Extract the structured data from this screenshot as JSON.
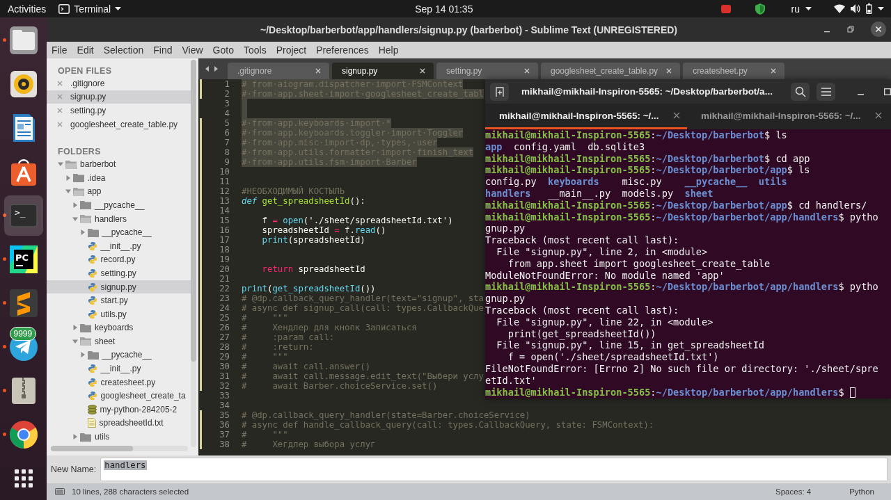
{
  "top_bar": {
    "activities": "Activities",
    "app_menu": "Terminal",
    "clock": "Sep 14  01:35",
    "keyboard_layout": "ru"
  },
  "dock": [
    {
      "kind": "files",
      "running": true,
      "active": false
    },
    {
      "kind": "music",
      "running": false,
      "active": false
    },
    {
      "kind": "writer",
      "running": false,
      "active": false
    },
    {
      "kind": "store",
      "running": false,
      "active": false
    },
    {
      "kind": "terminal",
      "label": ">_",
      "running": true,
      "active": true
    },
    {
      "kind": "pycharm",
      "label": "PC",
      "running": true,
      "active": false
    },
    {
      "kind": "sublime",
      "running": true,
      "active": false
    },
    {
      "kind": "telegram",
      "badge": "9999",
      "running": true,
      "active": false
    },
    {
      "kind": "archive",
      "running": true,
      "active": false
    },
    {
      "kind": "chrome",
      "running": true,
      "active": false
    },
    {
      "kind": "apps",
      "running": false,
      "active": false
    }
  ],
  "sublime": {
    "title": "~/Desktop/barberbot/app/handlers/signup.py (barberbot) - Sublime Text (UNREGISTERED)",
    "menu": [
      "File",
      "Edit",
      "Selection",
      "Find",
      "View",
      "Goto",
      "Tools",
      "Project",
      "Preferences",
      "Help"
    ],
    "sidebar": {
      "open_files_heading": "OPEN FILES",
      "open_files": [
        {
          "label": ".gitignore",
          "selected": false
        },
        {
          "label": "signup.py",
          "selected": true
        },
        {
          "label": "setting.py",
          "selected": false
        },
        {
          "label": "googlesheet_create_table.py",
          "selected": false
        }
      ],
      "folders_heading": "FOLDERS",
      "folders": [
        {
          "label": "barberbot",
          "kind": "folder",
          "expanded": true,
          "selected": false,
          "children": [
            {
              "label": ".idea",
              "kind": "folder",
              "expanded": false,
              "selected": false
            },
            {
              "label": "app",
              "kind": "folder",
              "expanded": true,
              "selected": false,
              "children": [
                {
                  "label": "__pycache__",
                  "kind": "folder",
                  "expanded": false,
                  "selected": false
                },
                {
                  "label": "handlers",
                  "kind": "folder",
                  "expanded": true,
                  "selected": false,
                  "children": [
                    {
                      "label": "__pycache__",
                      "kind": "folder",
                      "expanded": false,
                      "selected": false
                    },
                    {
                      "label": "__init__.py",
                      "kind": "python",
                      "selected": false
                    },
                    {
                      "label": "record.py",
                      "kind": "python",
                      "selected": false
                    },
                    {
                      "label": "setting.py",
                      "kind": "python",
                      "selected": false
                    },
                    {
                      "label": "signup.py",
                      "kind": "python",
                      "selected": true
                    },
                    {
                      "label": "start.py",
                      "kind": "python",
                      "selected": false
                    },
                    {
                      "label": "utils.py",
                      "kind": "python",
                      "selected": false
                    }
                  ]
                },
                {
                  "label": "keyboards",
                  "kind": "folder",
                  "expanded": false,
                  "selected": false
                },
                {
                  "label": "sheet",
                  "kind": "folder",
                  "expanded": true,
                  "selected": false,
                  "children": [
                    {
                      "label": "__pycache__",
                      "kind": "folder",
                      "expanded": false,
                      "selected": false
                    },
                    {
                      "label": "__init__.py",
                      "kind": "python",
                      "selected": false
                    },
                    {
                      "label": "createsheet.py",
                      "kind": "python",
                      "selected": false
                    },
                    {
                      "label": "googlesheet_create_ta",
                      "kind": "python",
                      "selected": false
                    },
                    {
                      "label": "my-python-284205-2",
                      "kind": "data",
                      "selected": false
                    },
                    {
                      "label": "spreadsheetId.txt",
                      "kind": "text",
                      "selected": false
                    }
                  ]
                },
                {
                  "label": "utils",
                  "kind": "folder",
                  "expanded": false,
                  "selected": false
                }
              ]
            }
          ]
        }
      ]
    },
    "tabs": [
      {
        "label": ".gitignore",
        "selected": false
      },
      {
        "label": "signup.py",
        "selected": true
      },
      {
        "label": "setting.py",
        "selected": false
      },
      {
        "label": "googlesheet_create_table.py",
        "selected": false
      },
      {
        "label": "createsheet.py",
        "selected": false
      }
    ],
    "code": [
      {
        "n": "1",
        "modified": true,
        "selected": true,
        "segments": [
          {
            "kind": "comment",
            "text": "# from·aiogram.dispatcher·import·FSMContext"
          }
        ]
      },
      {
        "n": "2",
        "modified": true,
        "selected": true,
        "segments": [
          {
            "kind": "comment",
            "text": "#·from·app.sheet·import·googlesheet_create_tabl"
          }
        ]
      },
      {
        "n": "3",
        "modified": false,
        "selected": true
      },
      {
        "n": "4",
        "modified": false,
        "selected": true
      },
      {
        "n": "5",
        "modified": true,
        "selected": true,
        "segments": [
          {
            "kind": "comment",
            "text": "#·from·app.keyboards·import·*"
          }
        ]
      },
      {
        "n": "6",
        "modified": true,
        "selected": true,
        "segments": [
          {
            "kind": "comment",
            "text": "#·from·app.keyboards.toggler·import·Toggler"
          }
        ]
      },
      {
        "n": "7",
        "modified": true,
        "selected": true,
        "segments": [
          {
            "kind": "comment",
            "text": "#·from·app.misc·import·dp,·types,·user"
          }
        ]
      },
      {
        "n": "8",
        "modified": true,
        "selected": true,
        "segments": [
          {
            "kind": "comment",
            "text": "#·from·app.utils.formatter·import·finish_text"
          }
        ]
      },
      {
        "n": "9",
        "modified": true,
        "selected": true,
        "segments": [
          {
            "kind": "comment",
            "text": "#·from·app.utils.fsm·import·Barber"
          }
        ]
      },
      {
        "n": "10",
        "modified": true,
        "selected": false
      },
      {
        "n": "11",
        "modified": true,
        "selected": false
      },
      {
        "n": "12",
        "modified": true,
        "selected": false,
        "segments": [
          {
            "kind": "comment",
            "text": "#НЕОБХОДИМЫЙ КОСТЫЛЬ"
          }
        ]
      },
      {
        "n": "13",
        "modified": true,
        "selected": false,
        "segments": [
          {
            "kind": "keyword",
            "text": "def"
          },
          {
            "kind": "name",
            "text": " get_spreadsheetId"
          },
          {
            "kind": "text",
            "text": "():"
          }
        ]
      },
      {
        "n": "14",
        "modified": true,
        "selected": false
      },
      {
        "n": "15",
        "modified": true,
        "selected": false,
        "segments": [
          {
            "kind": "text",
            "text": "    f "
          },
          {
            "kind": "operator",
            "text": "="
          },
          {
            "kind": "builtin",
            "text": " open"
          },
          {
            "kind": "text",
            "text": "('./sheet/spreadsheetId.txt')"
          }
        ]
      },
      {
        "n": "16",
        "modified": true,
        "selected": false,
        "segments": [
          {
            "kind": "text",
            "text": "    spreadsheetId "
          },
          {
            "kind": "operator",
            "text": "="
          },
          {
            "kind": "text",
            "text": " f."
          },
          {
            "kind": "builtin",
            "text": "read"
          },
          {
            "kind": "text",
            "text": "()"
          }
        ]
      },
      {
        "n": "17",
        "modified": true,
        "selected": false,
        "segments": [
          {
            "kind": "builtin",
            "text": "    print"
          },
          {
            "kind": "text",
            "text": "(spreadsheetId)"
          }
        ]
      },
      {
        "n": "18",
        "modified": true,
        "selected": false
      },
      {
        "n": "19",
        "modified": true,
        "selected": false
      },
      {
        "n": "20",
        "modified": true,
        "selected": false,
        "segments": [
          {
            "kind": "control",
            "text": "    return"
          },
          {
            "kind": "text",
            "text": " spreadsheetId"
          }
        ]
      },
      {
        "n": "21",
        "modified": true,
        "selected": false
      },
      {
        "n": "22",
        "modified": true,
        "selected": false,
        "segments": [
          {
            "kind": "builtin",
            "text": "print"
          },
          {
            "kind": "text",
            "text": "("
          },
          {
            "kind": "builtin",
            "text": "get_spreadsheetId"
          },
          {
            "kind": "text",
            "text": "())"
          }
        ]
      },
      {
        "n": "23",
        "modified": true,
        "selected": false,
        "segments": [
          {
            "kind": "comment",
            "text": "# @dp.callback_query_handler(text=\"signup\", sta"
          }
        ]
      },
      {
        "n": "24",
        "modified": true,
        "selected": false,
        "segments": [
          {
            "kind": "comment",
            "text": "# async def signup_call(call: types.CallbackQue"
          }
        ]
      },
      {
        "n": "25",
        "modified": true,
        "selected": false,
        "segments": [
          {
            "kind": "comment",
            "text": "#     \"\"\""
          }
        ]
      },
      {
        "n": "26",
        "modified": true,
        "selected": false,
        "segments": [
          {
            "kind": "comment",
            "text": "#     Хендлер для кнопк Записаться"
          }
        ]
      },
      {
        "n": "27",
        "modified": true,
        "selected": false,
        "segments": [
          {
            "kind": "comment",
            "text": "#     :param call:"
          }
        ]
      },
      {
        "n": "28",
        "modified": true,
        "selected": false,
        "segments": [
          {
            "kind": "comment",
            "text": "#     :return:"
          }
        ]
      },
      {
        "n": "29",
        "modified": true,
        "selected": false,
        "segments": [
          {
            "kind": "comment",
            "text": "#     \"\"\""
          }
        ]
      },
      {
        "n": "30",
        "modified": true,
        "selected": false,
        "segments": [
          {
            "kind": "comment",
            "text": "#     await call.answer()"
          }
        ]
      },
      {
        "n": "31",
        "modified": true,
        "selected": false,
        "segments": [
          {
            "kind": "comment",
            "text": "#     await call.message.edit_text(\"Выбери услу"
          }
        ]
      },
      {
        "n": "32",
        "modified": true,
        "selected": false,
        "segments": [
          {
            "kind": "comment",
            "text": "#     await Barber.choiceService.set()"
          }
        ]
      },
      {
        "n": "33",
        "modified": false,
        "selected": false
      },
      {
        "n": "34",
        "modified": false,
        "selected": false
      },
      {
        "n": "35",
        "modified": true,
        "selected": false,
        "segments": [
          {
            "kind": "comment",
            "text": "# @dp.callback_query_handler(state=Barber.choiceService)"
          }
        ]
      },
      {
        "n": "36",
        "modified": true,
        "selected": false,
        "segments": [
          {
            "kind": "comment",
            "text": "# async def handle_callback_query(call: types.CallbackQuery, state: FSMContext):"
          }
        ]
      },
      {
        "n": "37",
        "modified": true,
        "selected": false,
        "segments": [
          {
            "kind": "comment",
            "text": "#     \"\"\""
          }
        ]
      },
      {
        "n": "38",
        "modified": true,
        "selected": false,
        "segments": [
          {
            "kind": "comment",
            "text": "#     Хегдлер выбора услуг"
          }
        ]
      }
    ],
    "rename": {
      "label": "New Name:",
      "value": "handlers"
    },
    "status_bar": {
      "selection": "10 lines, 288 characters selected",
      "indentation": "Spaces: 4",
      "syntax": "Python"
    }
  },
  "terminal": {
    "title": "mikhail@mikhail-Inspiron-5565: ~/Desktop/barberbot/a...",
    "tabs": [
      {
        "label": "mikhail@mikhail-Inspiron-5565: ~/...",
        "selected": true
      },
      {
        "label": "mikhail@mikhail-Inspiron-5565: ~/...",
        "selected": false
      }
    ],
    "lines": [
      [
        {
          "kind": "user",
          "text": "mikhail@mikhail-Inspiron-5565"
        },
        {
          "kind": "plain",
          "text": ":"
        },
        {
          "kind": "path",
          "text": "~/Desktop/barberbot"
        },
        {
          "kind": "plain",
          "text": "$ ls"
        }
      ],
      [
        {
          "kind": "dir",
          "text": "app"
        },
        {
          "kind": "plain",
          "text": "  config.yaml  db.sqlite3"
        }
      ],
      [
        {
          "kind": "user",
          "text": "mikhail@mikhail-Inspiron-5565"
        },
        {
          "kind": "plain",
          "text": ":"
        },
        {
          "kind": "path",
          "text": "~/Desktop/barberbot"
        },
        {
          "kind": "plain",
          "text": "$ cd app"
        }
      ],
      [
        {
          "kind": "user",
          "text": "mikhail@mikhail-Inspiron-5565"
        },
        {
          "kind": "plain",
          "text": ":"
        },
        {
          "kind": "path",
          "text": "~/Desktop/barberbot/app"
        },
        {
          "kind": "plain",
          "text": "$ ls"
        }
      ],
      [
        {
          "kind": "plain",
          "text": "config.py  "
        },
        {
          "kind": "dir",
          "text": "keyboards"
        },
        {
          "kind": "plain",
          "text": "    misc.py    "
        },
        {
          "kind": "dir",
          "text": "__pycache__"
        },
        {
          "kind": "dir",
          "text": "  utils"
        }
      ],
      [
        {
          "kind": "dir",
          "text": "handlers"
        },
        {
          "kind": "plain",
          "text": "   __main__.py  models.py  "
        },
        {
          "kind": "dir",
          "text": "sheet"
        }
      ],
      [
        {
          "kind": "user",
          "text": "mikhail@mikhail-Inspiron-5565"
        },
        {
          "kind": "plain",
          "text": ":"
        },
        {
          "kind": "path",
          "text": "~/Desktop/barberbot/app"
        },
        {
          "kind": "plain",
          "text": "$ cd handlers/"
        }
      ],
      [
        {
          "kind": "user",
          "text": "mikhail@mikhail-Inspiron-5565"
        },
        {
          "kind": "plain",
          "text": ":"
        },
        {
          "kind": "path",
          "text": "~/Desktop/barberbot/app/handlers"
        },
        {
          "kind": "plain",
          "text": "$ pytho"
        }
      ],
      [
        {
          "kind": "plain",
          "text": "gnup.py"
        }
      ],
      [
        {
          "kind": "plain",
          "text": "Traceback (most recent call last):"
        }
      ],
      [
        {
          "kind": "plain",
          "text": "  File \"signup.py\", line 2, in <module>"
        }
      ],
      [
        {
          "kind": "plain",
          "text": "    from app.sheet import googlesheet_create_table"
        }
      ],
      [
        {
          "kind": "plain",
          "text": "ModuleNotFoundError: No module named 'app'"
        }
      ],
      [
        {
          "kind": "user",
          "text": "mikhail@mikhail-Inspiron-5565"
        },
        {
          "kind": "plain",
          "text": ":"
        },
        {
          "kind": "path",
          "text": "~/Desktop/barberbot/app/handlers"
        },
        {
          "kind": "plain",
          "text": "$ pytho"
        }
      ],
      [
        {
          "kind": "plain",
          "text": "gnup.py"
        }
      ],
      [
        {
          "kind": "plain",
          "text": "Traceback (most recent call last):"
        }
      ],
      [
        {
          "kind": "plain",
          "text": "  File \"signup.py\", line 22, in <module>"
        }
      ],
      [
        {
          "kind": "plain",
          "text": "    print(get_spreadsheetId())"
        }
      ],
      [
        {
          "kind": "plain",
          "text": "  File \"signup.py\", line 15, in get_spreadsheetId"
        }
      ],
      [
        {
          "kind": "plain",
          "text": "    f = open('./sheet/spreadsheetId.txt')"
        }
      ],
      [
        {
          "kind": "plain",
          "text": "FileNotFoundError: [Errno 2] No such file or directory: './sheet/spre"
        }
      ],
      [
        {
          "kind": "plain",
          "text": "etId.txt'"
        }
      ],
      [
        {
          "kind": "user",
          "text": "mikhail@mikhail-Inspiron-5565"
        },
        {
          "kind": "plain",
          "text": ":"
        },
        {
          "kind": "path",
          "text": "~/Desktop/barberbot/app/handlers"
        },
        {
          "kind": "plain",
          "text": "$ "
        },
        {
          "kind": "cursor"
        }
      ]
    ]
  }
}
